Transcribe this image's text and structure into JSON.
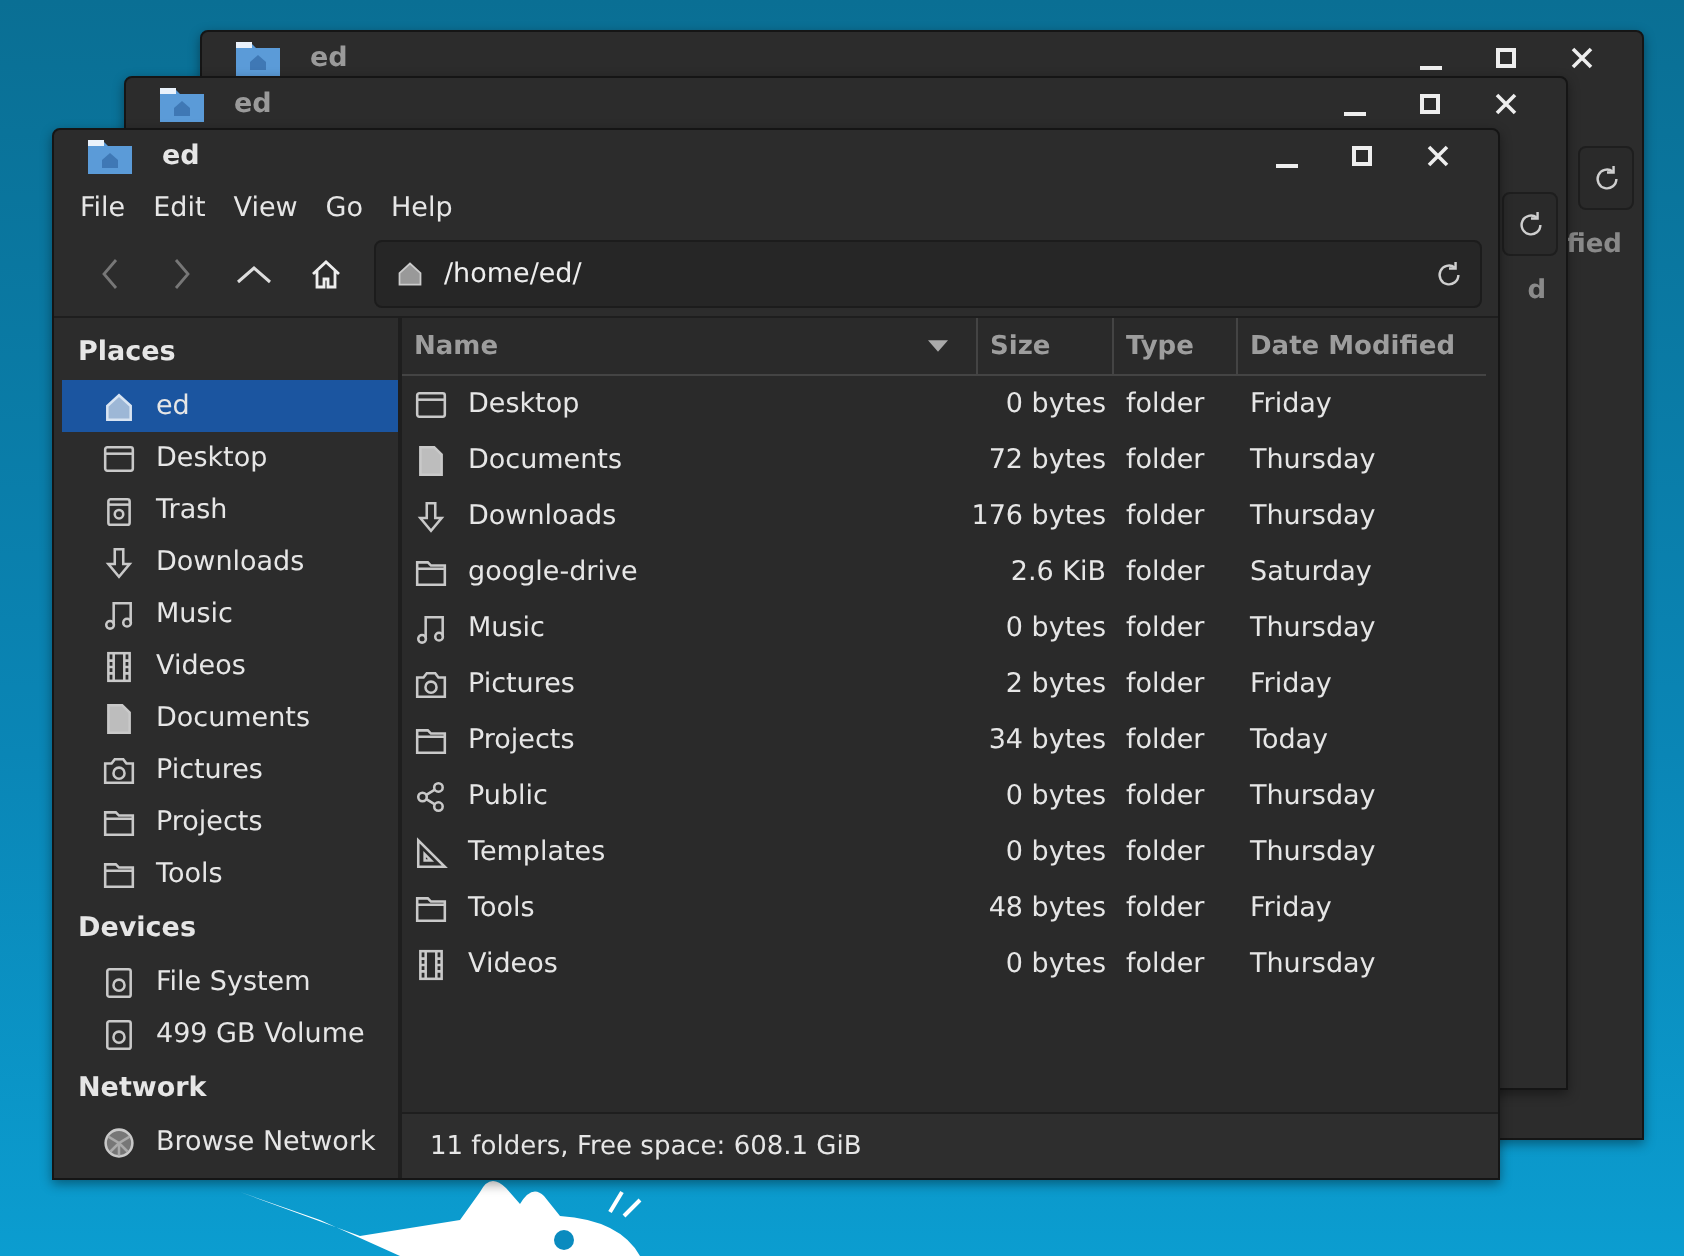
{
  "background_windows": [
    {
      "title": "ed",
      "header_fragment": "fied"
    },
    {
      "title": "ed",
      "header_fragment": "d"
    }
  ],
  "window": {
    "title": "ed"
  },
  "menu": [
    "File",
    "Edit",
    "View",
    "Go",
    "Help"
  ],
  "location": {
    "value": "/home/ed/"
  },
  "sidebar": [
    {
      "heading": "Places",
      "items": [
        {
          "label": "ed",
          "kind": "home",
          "selected": true
        },
        {
          "label": "Desktop",
          "kind": "desktop",
          "selected": false
        },
        {
          "label": "Trash",
          "kind": "trash",
          "selected": false
        },
        {
          "label": "Downloads",
          "kind": "download",
          "selected": false
        },
        {
          "label": "Music",
          "kind": "music",
          "selected": false
        },
        {
          "label": "Videos",
          "kind": "video",
          "selected": false
        },
        {
          "label": "Documents",
          "kind": "document",
          "selected": false
        },
        {
          "label": "Pictures",
          "kind": "camera",
          "selected": false
        },
        {
          "label": "Projects",
          "kind": "folder",
          "selected": false
        },
        {
          "label": "Tools",
          "kind": "folder",
          "selected": false
        }
      ]
    },
    {
      "heading": "Devices",
      "items": [
        {
          "label": "File System",
          "kind": "drive",
          "selected": false
        },
        {
          "label": "499 GB Volume",
          "kind": "drive",
          "selected": false
        }
      ]
    },
    {
      "heading": "Network",
      "items": [
        {
          "label": "Browse Network",
          "kind": "network",
          "selected": false
        }
      ]
    }
  ],
  "table": {
    "columns": [
      {
        "label": "Name",
        "sorted": true
      },
      {
        "label": "Size",
        "sorted": false
      },
      {
        "label": "Type",
        "sorted": false
      },
      {
        "label": "Date Modified",
        "sorted": false
      }
    ],
    "rows": [
      {
        "name": "Desktop",
        "size": "0 bytes",
        "type": "folder",
        "modified": "Friday",
        "kind": "desktop"
      },
      {
        "name": "Documents",
        "size": "72 bytes",
        "type": "folder",
        "modified": "Thursday",
        "kind": "document"
      },
      {
        "name": "Downloads",
        "size": "176 bytes",
        "type": "folder",
        "modified": "Thursday",
        "kind": "download"
      },
      {
        "name": "google-drive",
        "size": "2.6 KiB",
        "type": "folder",
        "modified": "Saturday",
        "kind": "folder"
      },
      {
        "name": "Music",
        "size": "0 bytes",
        "type": "folder",
        "modified": "Thursday",
        "kind": "music"
      },
      {
        "name": "Pictures",
        "size": "2 bytes",
        "type": "folder",
        "modified": "Friday",
        "kind": "camera"
      },
      {
        "name": "Projects",
        "size": "34 bytes",
        "type": "folder",
        "modified": "Today",
        "kind": "folder"
      },
      {
        "name": "Public",
        "size": "0 bytes",
        "type": "folder",
        "modified": "Thursday",
        "kind": "share"
      },
      {
        "name": "Templates",
        "size": "0 bytes",
        "type": "folder",
        "modified": "Thursday",
        "kind": "template"
      },
      {
        "name": "Tools",
        "size": "48 bytes",
        "type": "folder",
        "modified": "Friday",
        "kind": "folder"
      },
      {
        "name": "Videos",
        "size": "0 bytes",
        "type": "folder",
        "modified": "Thursday",
        "kind": "video"
      }
    ]
  },
  "status_bar": "11 folders, Free space: 608.1 GiB"
}
